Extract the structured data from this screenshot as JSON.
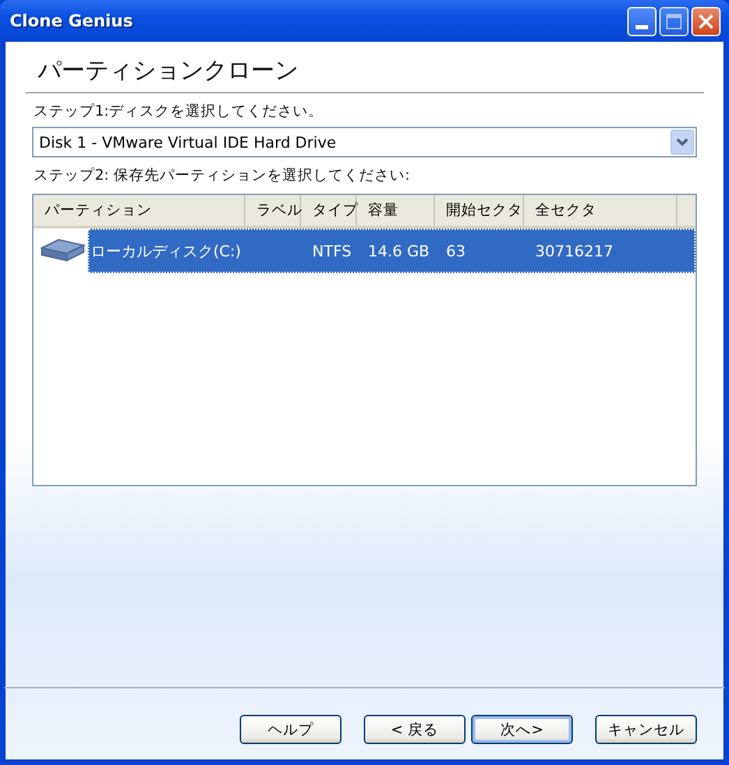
{
  "window": {
    "title": "Clone Genius"
  },
  "heading": "パーティションクローン",
  "step1": {
    "label": "ステップ1:ディスクを選択してください。",
    "value": "Disk 1 - VMware Virtual IDE Hard Drive"
  },
  "step2": {
    "label": "ステップ2: 保存先パーティションを選択してください:"
  },
  "table": {
    "columns": [
      "パーティション",
      "ラベル",
      "タイプ",
      "容量",
      "開始セクタ",
      "全セクタ"
    ],
    "rows": [
      {
        "cells": [
          "ローカルディスク(C:)",
          "",
          "NTFS",
          "14.6 GB",
          "63",
          "30716217"
        ],
        "selected": true
      }
    ]
  },
  "buttons": [
    {
      "label": "ヘルプ",
      "default": false
    },
    {
      "label": "< 戻る",
      "default": false
    },
    {
      "label": "次へ>",
      "default": true
    },
    {
      "label": "キャンセル",
      "default": false
    }
  ]
}
